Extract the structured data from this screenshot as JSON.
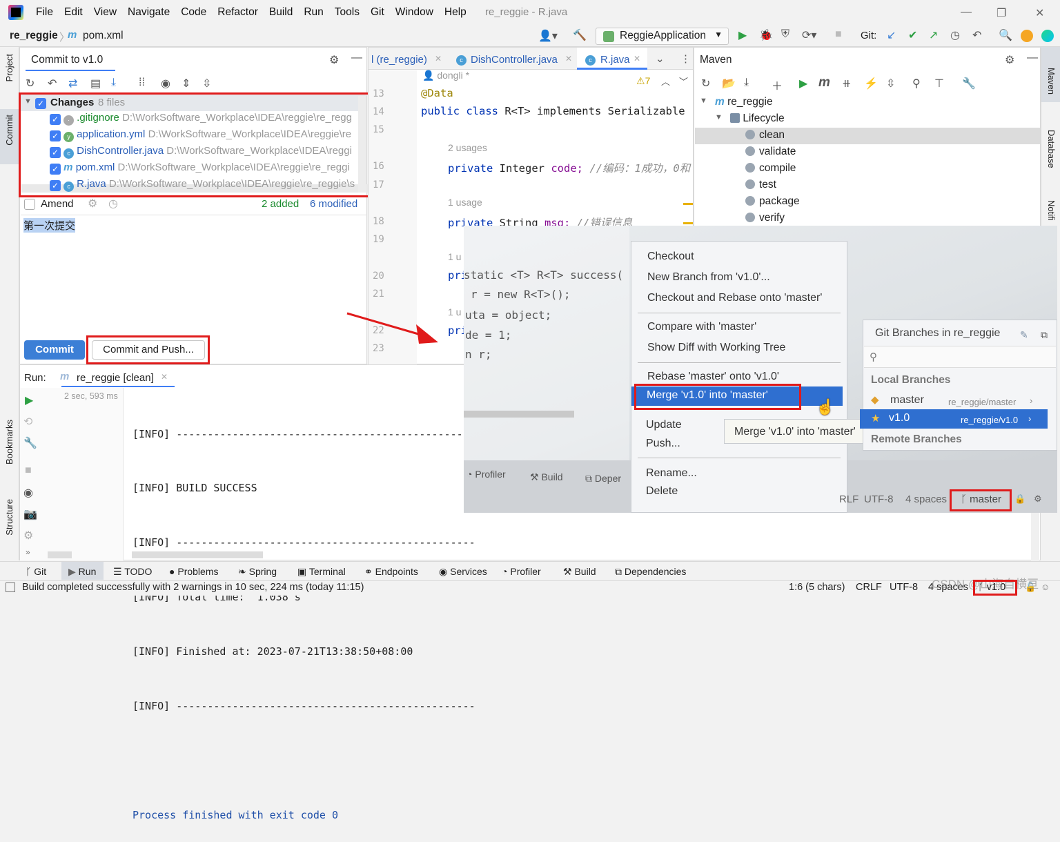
{
  "menu": [
    "File",
    "Edit",
    "View",
    "Navigate",
    "Code",
    "Refactor",
    "Build",
    "Run",
    "Tools",
    "Git",
    "Window",
    "Help"
  ],
  "window_title": "re_reggie - R.java",
  "breadcrumb": {
    "project": "re_reggie",
    "file": "pom.xml"
  },
  "run_config": "ReggieApplication",
  "git_label": "Git:",
  "commit_panel": {
    "title": "Commit to v1.0",
    "changes_label": "Changes",
    "changes_count": "8 files",
    "files": [
      {
        "name": ".gitignore",
        "path": "D:\\WorkSoftware_Workplace\\IDEA\\reggie\\re_regg"
      },
      {
        "name": "application.yml",
        "path": "D:\\WorkSoftware_Workplace\\IDEA\\reggie\\re"
      },
      {
        "name": "DishController.java",
        "path": "D:\\WorkSoftware_Workplace\\IDEA\\reggi"
      },
      {
        "name": "pom.xml",
        "path": "D:\\WorkSoftware_Workplace\\IDEA\\reggie\\re_reggi"
      },
      {
        "name": "R.java",
        "path": "D:\\WorkSoftware_Workplace\\IDEA\\reggie\\re_reggie\\s"
      }
    ],
    "amend_label": "Amend",
    "added": "2 added",
    "modified": "6 modified",
    "message": "第一次提交",
    "commit_button": "Commit",
    "commit_push_button": "Commit and Push..."
  },
  "editor": {
    "tabs": [
      "l (re_reggie)",
      "DishController.java",
      "R.java"
    ],
    "author": "dongli *",
    "warnings": "7",
    "line_numbers": [
      "13",
      "14",
      "15",
      "16",
      "17",
      "18",
      "19",
      "20",
      "21",
      "22",
      "23"
    ],
    "annotation": "@Data",
    "class_decl_kw": "public class",
    "class_decl_rest": "R<T> implements",
    "class_decl_type": "Serializable",
    "usages_2": "2 usages",
    "code_field_kw": "private",
    "code_field_type": "Integer",
    "code_field_name": "code;",
    "code_field_comment": "//编码：1成功，0和",
    "usage_1": "1 usage",
    "msg_field_kw": "private",
    "msg_field_type": "String",
    "msg_field_name": "msg;",
    "msg_field_comment": "//错误信息",
    "usage_1b": "1 u",
    "pri": "pri",
    "usage_1c": "1 u",
    "pri2": "pri"
  },
  "maven": {
    "title": "Maven",
    "project": "re_reggie",
    "lifecycle": "Lifecycle",
    "goals": [
      "clean",
      "validate",
      "compile",
      "test",
      "package",
      "verify"
    ]
  },
  "run_panel": {
    "label": "Run:",
    "tab": "re_reggie [clean]",
    "time": "2 sec, 593 ms",
    "lines": [
      "[INFO] ------------------------------------------------",
      "[INFO] BUILD SUCCESS",
      "[INFO] ------------------------------------------------",
      "[INFO] Total time:  1.038 s",
      "[INFO] Finished at: 2023-07-21T13:38:50+08:00",
      "[INFO] ------------------------------------------------",
      "",
      "Process finished with exit code 0"
    ]
  },
  "side_labels": {
    "project": "Project",
    "commit": "Commit",
    "bookmarks": "Bookmarks",
    "structure": "Structure",
    "maven": "Maven",
    "database": "Database",
    "notifications": "Notifi"
  },
  "bottom_tabs": [
    "Git",
    "Run",
    "TODO",
    "Problems",
    "Spring",
    "Terminal",
    "Endpoints",
    "Services",
    "Profiler",
    "Build",
    "Dependencies"
  ],
  "status": {
    "message": "Build completed successfully with 2 warnings in 10 sec, 224 ms (today 11:15)",
    "position": "1:6 (5 chars)",
    "line_sep": "CRLF",
    "encoding": "UTF-8",
    "indent": "4 spaces",
    "branch": "v1.0",
    "watermark": "CSDN @山海自横亘"
  },
  "photo": {
    "code_lines": [
      "static <T> R<T> success(",
      "r = new R<T>();",
      "uta = object;",
      "de = 1;",
      "n r;"
    ],
    "menu_items": [
      "Checkout",
      "New Branch from 'v1.0'...",
      "Checkout and Rebase onto 'master'",
      "Compare with 'master'",
      "Show Diff with Working Tree",
      "Rebase 'master' onto 'v1.0'",
      "Merge 'v1.0' into 'master'",
      "Update",
      "Push...",
      "Rename...",
      "Delete"
    ],
    "tooltip": "Merge 'v1.0' into 'master'",
    "branches_title": "Git Branches in re_reggie",
    "local_branches": "Local Branches",
    "branches": [
      {
        "name": "master",
        "tracking": "re_reggie/master"
      },
      {
        "name": "v1.0",
        "tracking": "re_reggie/v1.0"
      }
    ],
    "remote_branches": "Remote Branches",
    "bottom_items": [
      "Profiler",
      "Build",
      "Deper"
    ],
    "status_items": [
      "RLF",
      "UTF-8",
      "4 spaces"
    ],
    "branch": "master"
  },
  "colors": {
    "accent": "#3f7ef5",
    "highlight_red": "#e01b1b",
    "selection": "#2f6fd0"
  }
}
